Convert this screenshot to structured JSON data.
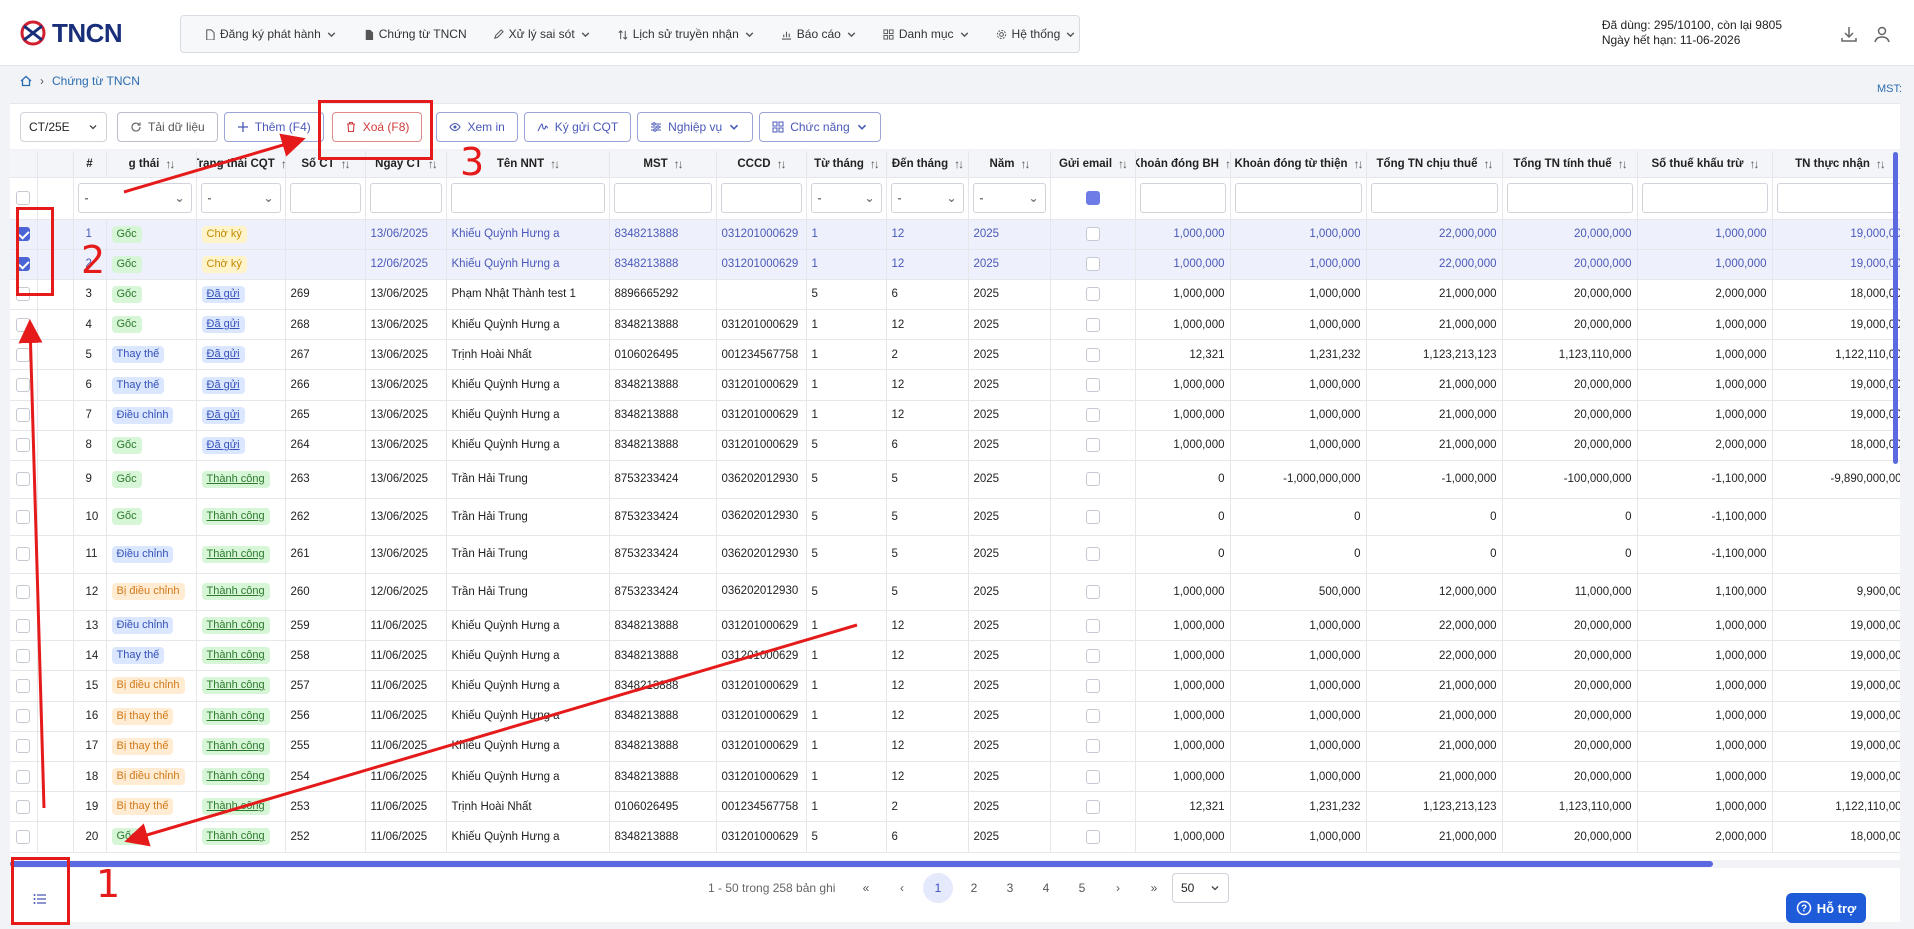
{
  "app": {
    "logo_text": "TNCN"
  },
  "menu": [
    {
      "label": "Đăng ký phát hành",
      "icon": "document-icon",
      "caret": true
    },
    {
      "label": "Chứng từ TNCN",
      "icon": "file-icon",
      "caret": false
    },
    {
      "label": "Xử lý sai sót",
      "icon": "edit-icon",
      "caret": true
    },
    {
      "label": "Lịch sử truyền nhận",
      "icon": "sort-icon",
      "caret": true
    },
    {
      "label": "Báo cáo",
      "icon": "chart-icon",
      "caret": true
    },
    {
      "label": "Danh mục",
      "icon": "grid-icon",
      "caret": true
    },
    {
      "label": "Hệ thống",
      "icon": "gear-icon",
      "caret": true
    }
  ],
  "user": {
    "usage": "Đã dùng: 295/10100, còn lại 9805",
    "expiry": "Ngày hết hạn: 11-06-2026"
  },
  "breadcrumb": {
    "current": "Chứng từ TNCN"
  },
  "mst_label": "MST:",
  "toolbar": {
    "template": "CT/25E",
    "buttons": {
      "reload": "Tải dữ liệu",
      "add": "Thêm (F4)",
      "delete": "Xoá (F8)",
      "view": "Xem in",
      "sign": "Ký gửi CQT",
      "business": "Nghiệp vụ",
      "functions": "Chức năng"
    }
  },
  "table": {
    "columns": [
      "#",
      "g thái",
      "Trạng thái CQT",
      "Số CT",
      "Ngày CT",
      "Tên NNT",
      "MST",
      "CCCD",
      "Từ tháng",
      "Đến tháng",
      "Năm",
      "Gửi email",
      "Khoản đóng BH",
      "Khoản đóng từ thiện",
      "Tổng TN chịu thuế",
      "Tổng TN tính thuế",
      "Số thuế khấu trừ",
      "TN thực nhận"
    ],
    "filter_placeholder": "-",
    "rows": [
      {
        "idx": "1",
        "checked": true,
        "status": "Gốc",
        "st": "goc",
        "cqt": "Chờ ký",
        "cq": "cho",
        "so": "",
        "ngay": "13/06/2025",
        "ten": "Khiếu Quỳnh Hưng a",
        "mst": "8348213888",
        "cccd": "031201000629",
        "tu": "1",
        "den": "12",
        "nam": "2025",
        "bh": "1,000,000",
        "tt": "1,000,000",
        "chiu": "22,000,000",
        "tinh": "20,000,000",
        "kt": "1,000,000",
        "tn": "19,000,00"
      },
      {
        "idx": "2",
        "checked": true,
        "status": "Gốc",
        "st": "goc",
        "cqt": "Chờ ký",
        "cq": "cho",
        "so": "",
        "ngay": "12/06/2025",
        "ten": "Khiếu Quỳnh Hưng a",
        "mst": "8348213888",
        "cccd": "031201000629",
        "tu": "1",
        "den": "12",
        "nam": "2025",
        "bh": "1,000,000",
        "tt": "1,000,000",
        "chiu": "22,000,000",
        "tinh": "20,000,000",
        "kt": "1,000,000",
        "tn": "19,000,00"
      },
      {
        "idx": "3",
        "checked": false,
        "status": "Gốc",
        "st": "goc",
        "cqt": "Đã gửi",
        "cq": "dg",
        "so": "269",
        "ngay": "13/06/2025",
        "ten": "Phạm Nhật Thành test 1",
        "mst": "8896665292",
        "cccd": "",
        "tu": "5",
        "den": "6",
        "nam": "2025",
        "bh": "1,000,000",
        "tt": "1,000,000",
        "chiu": "21,000,000",
        "tinh": "20,000,000",
        "kt": "2,000,000",
        "tn": "18,000,00"
      },
      {
        "idx": "4",
        "checked": false,
        "status": "Gốc",
        "st": "goc",
        "cqt": "Đã gửi",
        "cq": "dg",
        "so": "268",
        "ngay": "13/06/2025",
        "ten": "Khiếu Quỳnh Hưng a",
        "mst": "8348213888",
        "cccd": "031201000629",
        "tu": "1",
        "den": "12",
        "nam": "2025",
        "bh": "1,000,000",
        "tt": "1,000,000",
        "chiu": "21,000,000",
        "tinh": "20,000,000",
        "kt": "1,000,000",
        "tn": "19,000,00"
      },
      {
        "idx": "5",
        "checked": false,
        "status": "Thay thế",
        "st": "tt",
        "cqt": "Đã gửi",
        "cq": "dg",
        "so": "267",
        "ngay": "13/06/2025",
        "ten": "Trịnh Hoài Nhất",
        "mst": "0106026495",
        "cccd": "001234567758",
        "tu": "1",
        "den": "2",
        "nam": "2025",
        "bh": "12,321",
        "tt": "1,231,232",
        "chiu": "1,123,213,123",
        "tinh": "1,123,110,000",
        "kt": "1,000,000",
        "tn": "1,122,110,00"
      },
      {
        "idx": "6",
        "checked": false,
        "status": "Thay thế",
        "st": "tt",
        "cqt": "Đã gửi",
        "cq": "dg",
        "so": "266",
        "ngay": "13/06/2025",
        "ten": "Khiếu Quỳnh Hưng a",
        "mst": "8348213888",
        "cccd": "031201000629",
        "tu": "1",
        "den": "12",
        "nam": "2025",
        "bh": "1,000,000",
        "tt": "1,000,000",
        "chiu": "21,000,000",
        "tinh": "20,000,000",
        "kt": "1,000,000",
        "tn": "19,000,00"
      },
      {
        "idx": "7",
        "checked": false,
        "status": "Điều chỉnh",
        "st": "dc",
        "cqt": "Đã gửi",
        "cq": "dg",
        "so": "265",
        "ngay": "13/06/2025",
        "ten": "Khiếu Quỳnh Hưng a",
        "mst": "8348213888",
        "cccd": "031201000629",
        "tu": "1",
        "den": "12",
        "nam": "2025",
        "bh": "1,000,000",
        "tt": "1,000,000",
        "chiu": "21,000,000",
        "tinh": "20,000,000",
        "kt": "1,000,000",
        "tn": "19,000,00"
      },
      {
        "idx": "8",
        "checked": false,
        "status": "Gốc",
        "st": "goc",
        "cqt": "Đã gửi",
        "cq": "dg",
        "so": "264",
        "ngay": "13/06/2025",
        "ten": "Khiếu Quỳnh Hưng a",
        "mst": "8348213888",
        "cccd": "031201000629",
        "tu": "5",
        "den": "6",
        "nam": "2025",
        "bh": "1,000,000",
        "tt": "1,000,000",
        "chiu": "21,000,000",
        "tinh": "20,000,000",
        "kt": "2,000,000",
        "tn": "18,000,00"
      },
      {
        "idx": "9",
        "checked": false,
        "tall": true,
        "status": "Gốc",
        "st": "goc",
        "cqt": "Thành công",
        "cq": "tc",
        "so": "263",
        "ngay": "13/06/2025",
        "ten": "Trần Hải Trung",
        "mst": "8753233424",
        "cccd": "036202012930",
        "tu": "5",
        "den": "5",
        "nam": "2025",
        "bh": "0",
        "tt": "-1,000,000,000",
        "chiu": "-1,000,000",
        "tinh": "-100,000,000",
        "kt": "-1,100,000",
        "tn": "-9,890,000,00"
      },
      {
        "idx": "10",
        "checked": false,
        "tall": true,
        "status": "Gốc",
        "st": "goc",
        "cqt": "Thành công",
        "cq": "tc",
        "so": "262",
        "ngay": "13/06/2025",
        "ten": "Trần Hải Trung",
        "mst": "8753233424",
        "cccd": "036202012930",
        "tu": "5",
        "den": "5",
        "nam": "2025",
        "bh": "0",
        "tt": "0",
        "chiu": "0",
        "tinh": "0",
        "kt": "-1,100,000",
        "tn": ""
      },
      {
        "idx": "11",
        "checked": false,
        "tall": true,
        "status": "Điều chỉnh",
        "st": "dc",
        "cqt": "Thành công",
        "cq": "tc",
        "so": "261",
        "ngay": "13/06/2025",
        "ten": "Trần Hải Trung",
        "mst": "8753233424",
        "cccd": "036202012930",
        "tu": "5",
        "den": "5",
        "nam": "2025",
        "bh": "0",
        "tt": "0",
        "chiu": "0",
        "tinh": "0",
        "kt": "-1,100,000",
        "tn": ""
      },
      {
        "idx": "12",
        "checked": false,
        "tall": true,
        "status": "Bị điều chỉnh",
        "st": "bdc",
        "cqt": "Thành công",
        "cq": "tc",
        "so": "260",
        "ngay": "12/06/2025",
        "ten": "Trần Hải Trung",
        "mst": "8753233424",
        "cccd": "036202012930",
        "tu": "5",
        "den": "5",
        "nam": "2025",
        "bh": "1,000,000",
        "tt": "500,000",
        "chiu": "12,000,000",
        "tinh": "11,000,000",
        "kt": "1,100,000",
        "tn": "9,900,00"
      },
      {
        "idx": "13",
        "checked": false,
        "status": "Điều chỉnh",
        "st": "dc",
        "cqt": "Thành công",
        "cq": "tc",
        "so": "259",
        "ngay": "11/06/2025",
        "ten": "Khiếu Quỳnh Hưng a",
        "mst": "8348213888",
        "cccd": "031201000629",
        "tu": "1",
        "den": "12",
        "nam": "2025",
        "bh": "1,000,000",
        "tt": "1,000,000",
        "chiu": "22,000,000",
        "tinh": "20,000,000",
        "kt": "1,000,000",
        "tn": "19,000,00"
      },
      {
        "idx": "14",
        "checked": false,
        "status": "Thay thế",
        "st": "tt",
        "cqt": "Thành công",
        "cq": "tc",
        "so": "258",
        "ngay": "11/06/2025",
        "ten": "Khiếu Quỳnh Hưng a",
        "mst": "8348213888",
        "cccd": "031201000629",
        "tu": "1",
        "den": "12",
        "nam": "2025",
        "bh": "1,000,000",
        "tt": "1,000,000",
        "chiu": "22,000,000",
        "tinh": "20,000,000",
        "kt": "1,000,000",
        "tn": "19,000,00"
      },
      {
        "idx": "15",
        "checked": false,
        "status": "Bị điều chỉnh",
        "st": "bdc",
        "cqt": "Thành công",
        "cq": "tc",
        "so": "257",
        "ngay": "11/06/2025",
        "ten": "Khiếu Quỳnh Hưng a",
        "mst": "8348213888",
        "cccd": "031201000629",
        "tu": "1",
        "den": "12",
        "nam": "2025",
        "bh": "1,000,000",
        "tt": "1,000,000",
        "chiu": "21,000,000",
        "tinh": "20,000,000",
        "kt": "1,000,000",
        "tn": "19,000,00"
      },
      {
        "idx": "16",
        "checked": false,
        "status": "Bị thay thế",
        "st": "btt",
        "cqt": "Thành công",
        "cq": "tc",
        "so": "256",
        "ngay": "11/06/2025",
        "ten": "Khiếu Quỳnh Hưng a",
        "mst": "8348213888",
        "cccd": "031201000629",
        "tu": "1",
        "den": "12",
        "nam": "2025",
        "bh": "1,000,000",
        "tt": "1,000,000",
        "chiu": "21,000,000",
        "tinh": "20,000,000",
        "kt": "1,000,000",
        "tn": "19,000,00"
      },
      {
        "idx": "17",
        "checked": false,
        "status": "Bị thay thế",
        "st": "btt",
        "cqt": "Thành công",
        "cq": "tc",
        "so": "255",
        "ngay": "11/06/2025",
        "ten": "Khiếu Quỳnh Hưng a",
        "mst": "8348213888",
        "cccd": "031201000629",
        "tu": "1",
        "den": "12",
        "nam": "2025",
        "bh": "1,000,000",
        "tt": "1,000,000",
        "chiu": "21,000,000",
        "tinh": "20,000,000",
        "kt": "1,000,000",
        "tn": "19,000,00"
      },
      {
        "idx": "18",
        "checked": false,
        "status": "Bị điều chỉnh",
        "st": "bdc",
        "cqt": "Thành công",
        "cq": "tc",
        "so": "254",
        "ngay": "11/06/2025",
        "ten": "Khiếu Quỳnh Hưng a",
        "mst": "8348213888",
        "cccd": "031201000629",
        "tu": "1",
        "den": "12",
        "nam": "2025",
        "bh": "1,000,000",
        "tt": "1,000,000",
        "chiu": "21,000,000",
        "tinh": "20,000,000",
        "kt": "1,000,000",
        "tn": "19,000,00"
      },
      {
        "idx": "19",
        "checked": false,
        "status": "Bị thay thế",
        "st": "btt",
        "cqt": "Thành công",
        "cq": "tc",
        "so": "253",
        "ngay": "11/06/2025",
        "ten": "Trịnh Hoài Nhất",
        "mst": "0106026495",
        "cccd": "001234567758",
        "tu": "1",
        "den": "2",
        "nam": "2025",
        "bh": "12,321",
        "tt": "1,231,232",
        "chiu": "1,123,213,123",
        "tinh": "1,123,110,000",
        "kt": "1,000,000",
        "tn": "1,122,110,00"
      },
      {
        "idx": "20",
        "checked": false,
        "status": "Gốc",
        "st": "goc",
        "cqt": "Thành công",
        "cq": "tc",
        "so": "252",
        "ngay": "11/06/2025",
        "ten": "Khiếu Quỳnh Hưng a",
        "mst": "8348213888",
        "cccd": "031201000629",
        "tu": "5",
        "den": "6",
        "nam": "2025",
        "bh": "1,000,000",
        "tt": "1,000,000",
        "chiu": "21,000,000",
        "tinh": "20,000,000",
        "kt": "2,000,000",
        "tn": "18,000,00"
      }
    ]
  },
  "pagination": {
    "summary": "1 - 50 trong 258 bản ghi",
    "pages": [
      "1",
      "2",
      "3",
      "4",
      "5"
    ],
    "current": "1",
    "page_size": "50"
  },
  "support_label": "Hỗ trợ",
  "annotations": [
    "1",
    "2",
    "3"
  ],
  "colors": {
    "annotation": "#e51b1b",
    "accent": "#4a58b8",
    "scrollbar": "#5b6ae0"
  }
}
